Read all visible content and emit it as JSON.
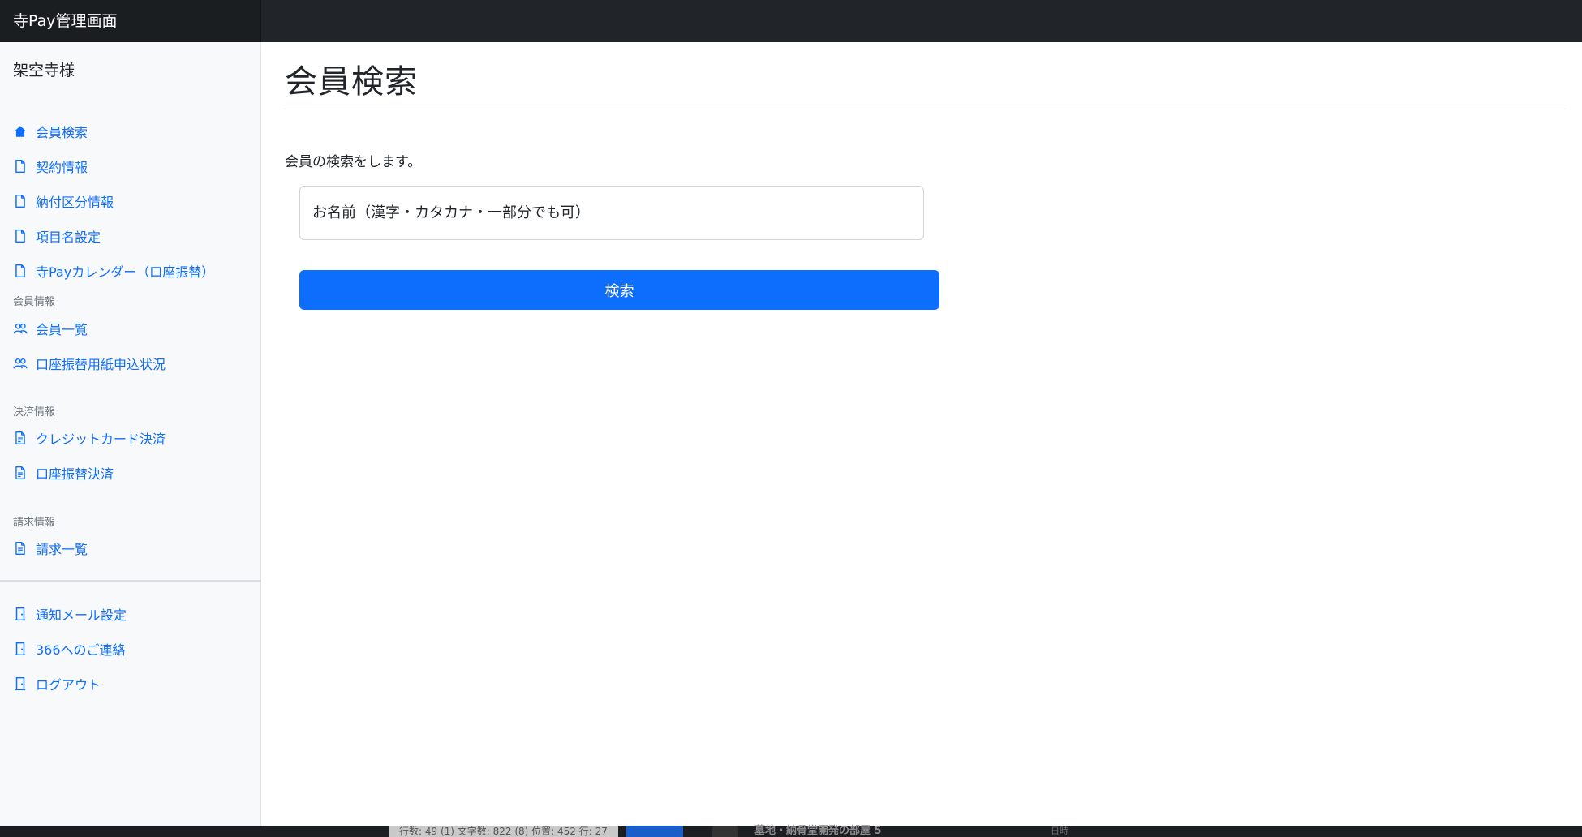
{
  "header": {
    "app_title": "寺Pay管理画面"
  },
  "sidebar": {
    "temple_name": "架空寺様",
    "main_items": [
      {
        "label": "会員検索",
        "icon": "home-icon"
      },
      {
        "label": "契約情報",
        "icon": "file-icon"
      },
      {
        "label": "納付区分情報",
        "icon": "file-icon"
      },
      {
        "label": "項目名設定",
        "icon": "file-icon"
      },
      {
        "label": "寺Payカレンダー（口座振替）",
        "icon": "file-icon"
      }
    ],
    "member_section": {
      "heading": "会員情報",
      "items": [
        {
          "label": "会員一覧",
          "icon": "users-icon"
        },
        {
          "label": "口座振替用紙申込状況",
          "icon": "users-icon"
        }
      ]
    },
    "payment_section": {
      "heading": "決済情報",
      "items": [
        {
          "label": "クレジットカード決済",
          "icon": "file-text-icon"
        },
        {
          "label": "口座振替決済",
          "icon": "file-text-icon"
        }
      ]
    },
    "billing_section": {
      "heading": "請求情報",
      "items": [
        {
          "label": "請求一覧",
          "icon": "file-text-icon"
        }
      ]
    },
    "footer_items": [
      {
        "label": "通知メール設定",
        "icon": "door-icon"
      },
      {
        "label": "366へのご連絡",
        "icon": "door-icon"
      },
      {
        "label": "ログアウト",
        "icon": "door-icon"
      }
    ]
  },
  "main": {
    "page_title": "会員検索",
    "lead": "会員の検索をします。",
    "search": {
      "placeholder": "お名前（漢字・カタカナ・一部分でも可）",
      "value": ""
    },
    "search_button_label": "検索"
  },
  "background_app": {
    "status_text": "行数: 49 (1)  文字数: 822 (8)  位置: 452  行: 27",
    "title": "墓地・納骨堂開発の部屋",
    "title_suffix": "5",
    "meta": "日時"
  },
  "colors": {
    "navbar": "#212529",
    "sidebar_bg": "#f8f9fa",
    "link": "#0d6efd",
    "primary_button": "#0d6efd"
  }
}
